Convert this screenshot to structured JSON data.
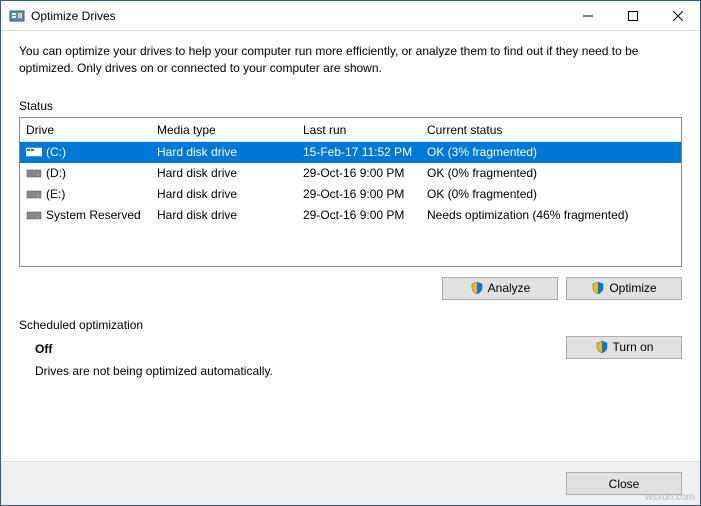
{
  "title": "Optimize Drives",
  "intro": "You can optimize your drives to help your computer run more efficiently, or analyze them to find out if they need to be optimized. Only drives on or connected to your computer are shown.",
  "status_label": "Status",
  "columns": {
    "drive": "Drive",
    "media": "Media type",
    "last": "Last run",
    "status": "Current status"
  },
  "rows": [
    {
      "drive": "(C:)",
      "media": "Hard disk drive",
      "last": "15-Feb-17 11:52 PM",
      "status": "OK (3% fragmented)",
      "selected": true,
      "icon": "windows"
    },
    {
      "drive": "(D:)",
      "media": "Hard disk drive",
      "last": "29-Oct-16 9:00 PM",
      "status": "OK (0% fragmented)",
      "selected": false,
      "icon": "hdd"
    },
    {
      "drive": "(E:)",
      "media": "Hard disk drive",
      "last": "29-Oct-16 9:00 PM",
      "status": "OK (0% fragmented)",
      "selected": false,
      "icon": "hdd"
    },
    {
      "drive": "System Reserved",
      "media": "Hard disk drive",
      "last": "29-Oct-16 9:00 PM",
      "status": "Needs optimization (46% fragmented)",
      "selected": false,
      "icon": "hdd"
    }
  ],
  "buttons": {
    "analyze": "Analyze",
    "optimize": "Optimize",
    "turn_on": "Turn on",
    "close": "Close"
  },
  "scheduled": {
    "label": "Scheduled optimization",
    "state": "Off",
    "desc": "Drives are not being optimized automatically."
  },
  "watermark": "wsxdn.com"
}
